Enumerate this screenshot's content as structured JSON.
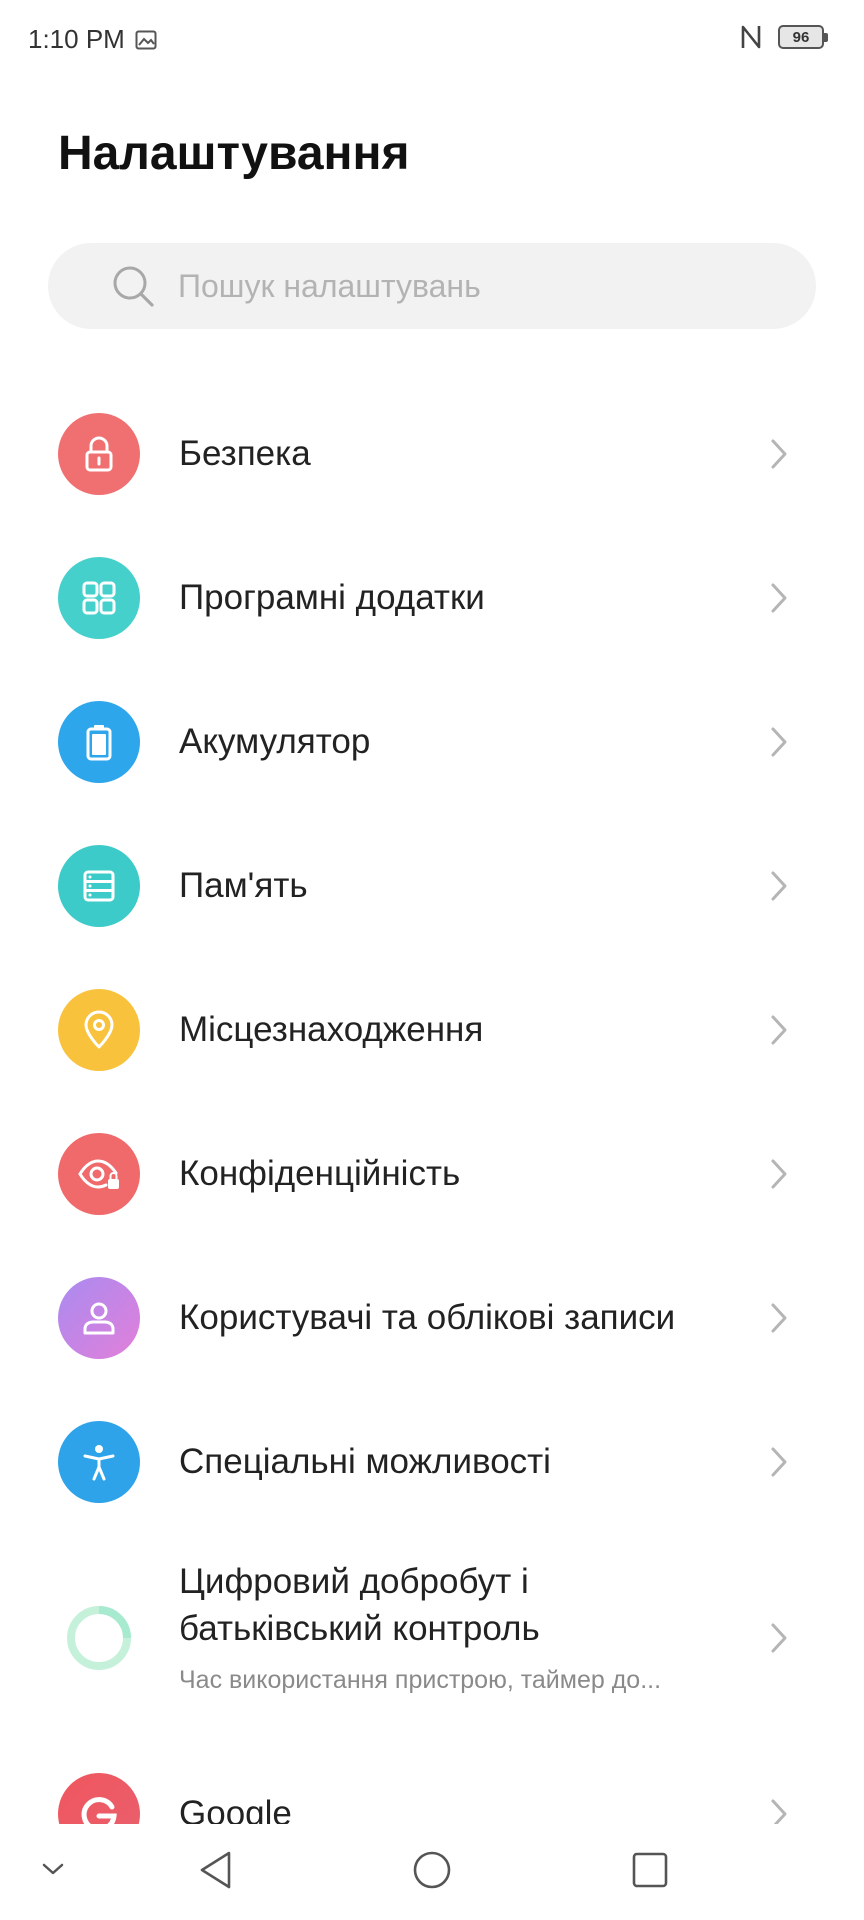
{
  "status_bar": {
    "time": "1:10 PM",
    "battery": "96",
    "nfc_icon": "nfc-icon",
    "image_icon": "image-icon"
  },
  "page": {
    "title": "Налаштування"
  },
  "search": {
    "placeholder": "Пошук налаштувань",
    "icon": "search-icon"
  },
  "settings": [
    {
      "label": "Безпека",
      "icon": "lock-icon",
      "color": "#f07072"
    },
    {
      "label": "Програмні додатки",
      "icon": "apps-grid-icon",
      "color": "#45d0cc"
    },
    {
      "label": "Акумулятор",
      "icon": "battery-icon",
      "color": "#2ea6ec"
    },
    {
      "label": "Пам'ять",
      "icon": "storage-icon",
      "color": "#3ccbc9"
    },
    {
      "label": "Місцезнаходження",
      "icon": "location-pin-icon",
      "color": "#f8c23d"
    },
    {
      "label": "Конфіденційність",
      "icon": "privacy-eye-icon",
      "color": "#f06a6c"
    },
    {
      "label": "Користувачі та облікові записи",
      "icon": "user-icon",
      "color": "#c47de6"
    },
    {
      "label": "Спеціальні можливості",
      "icon": "accessibility-icon",
      "color": "#2ea3ea"
    },
    {
      "label_line1": "Цифровий добробут і",
      "label_line2": "батьківський контроль",
      "sublabel": "Час використання пристрою, таймер до...",
      "icon": "digital-wellbeing-icon",
      "color": "#7fe0b3"
    },
    {
      "label": "Google",
      "icon": "google-icon",
      "color": "#ea4d5a"
    }
  ],
  "nav_bar": {
    "collapse": "chevron-down-icon",
    "back": "back-icon",
    "home": "home-icon",
    "recents": "recents-icon"
  }
}
